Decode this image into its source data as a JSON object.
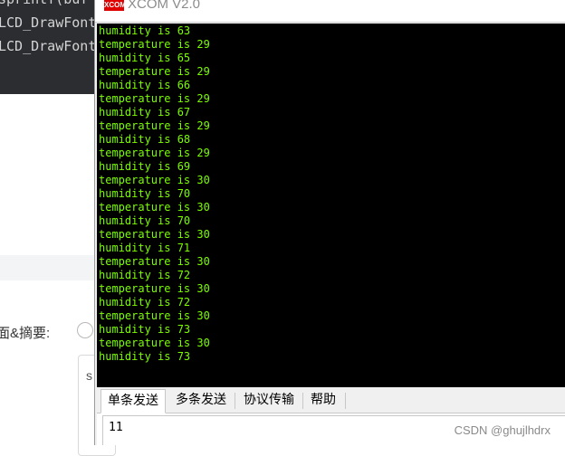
{
  "background": {
    "code_lines": [
      "sprintf(buf",
      "LCD_DrawFont",
      "LCD_DrawFont"
    ],
    "summary_label": "面&摘要:",
    "input_partial": "s"
  },
  "xcom": {
    "logo_text": "XCOM",
    "title": "XCOM V2.0",
    "receive_lines": [
      "humidity is 63",
      "temperature is 29",
      "humidity is 65",
      "temperature is 29",
      "humidity is 66",
      "temperature is 29",
      "humidity is 67",
      "temperature is 29",
      "humidity is 68",
      "temperature is 29",
      "humidity is 69",
      "temperature is 30",
      "humidity is 70",
      "temperature is 30",
      "humidity is 70",
      "temperature is 30",
      "humidity is 71",
      "temperature is 30",
      "humidity is 72",
      "temperature is 30",
      "humidity is 72",
      "temperature is 30",
      "humidity is 73",
      "temperature is 30",
      "humidity is 73"
    ],
    "tabs": [
      "单条发送",
      "多条发送",
      "协议传输",
      "帮助"
    ],
    "active_tab": "单条发送",
    "send_value": "11",
    "terminal_text_color": "#7cfc00",
    "terminal_bg_color": "#000000",
    "logo_color": "#e00000"
  },
  "watermark": "CSDN @ghujlhdrx"
}
